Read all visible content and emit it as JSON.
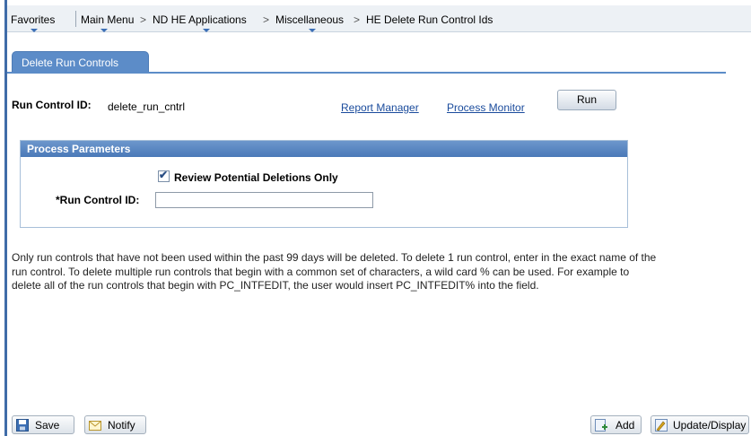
{
  "breadcrumb": {
    "items": [
      "Favorites",
      "Main Menu",
      "ND HE Applications",
      "Miscellaneous",
      "HE Delete Run Control Ids"
    ],
    "separator": ">"
  },
  "tabs": [
    {
      "label": "Delete Run Controls",
      "active": true
    }
  ],
  "run_control": {
    "label": "Run Control ID:",
    "value": "delete_run_cntrl",
    "report_manager": "Report Manager",
    "process_monitor": "Process Monitor",
    "run_label": "Run"
  },
  "process_parameters": {
    "title": "Process Parameters",
    "review_label": "Review Potential Deletions Only",
    "review_checked": true,
    "run_control_label": "*Run Control ID:",
    "run_control_value": ""
  },
  "info_text": "Only run controls that have not been used within the past 99 days will be deleted. To delete 1 run control, enter in the exact name of the run control. To delete multiple run controls that begin with a common set of characters, a wild card % can be used. For example to delete all of the run controls that begin with PC_INTFEDIT, the user would insert PC_INTFEDIT% into the field.",
  "footer": {
    "save": "Save",
    "notify": "Notify",
    "add": "Add",
    "update_display": "Update/Display"
  },
  "colors": {
    "accent": "#5c8cc8",
    "link": "#1a4b9c",
    "header_bar": "#edf1f5"
  }
}
